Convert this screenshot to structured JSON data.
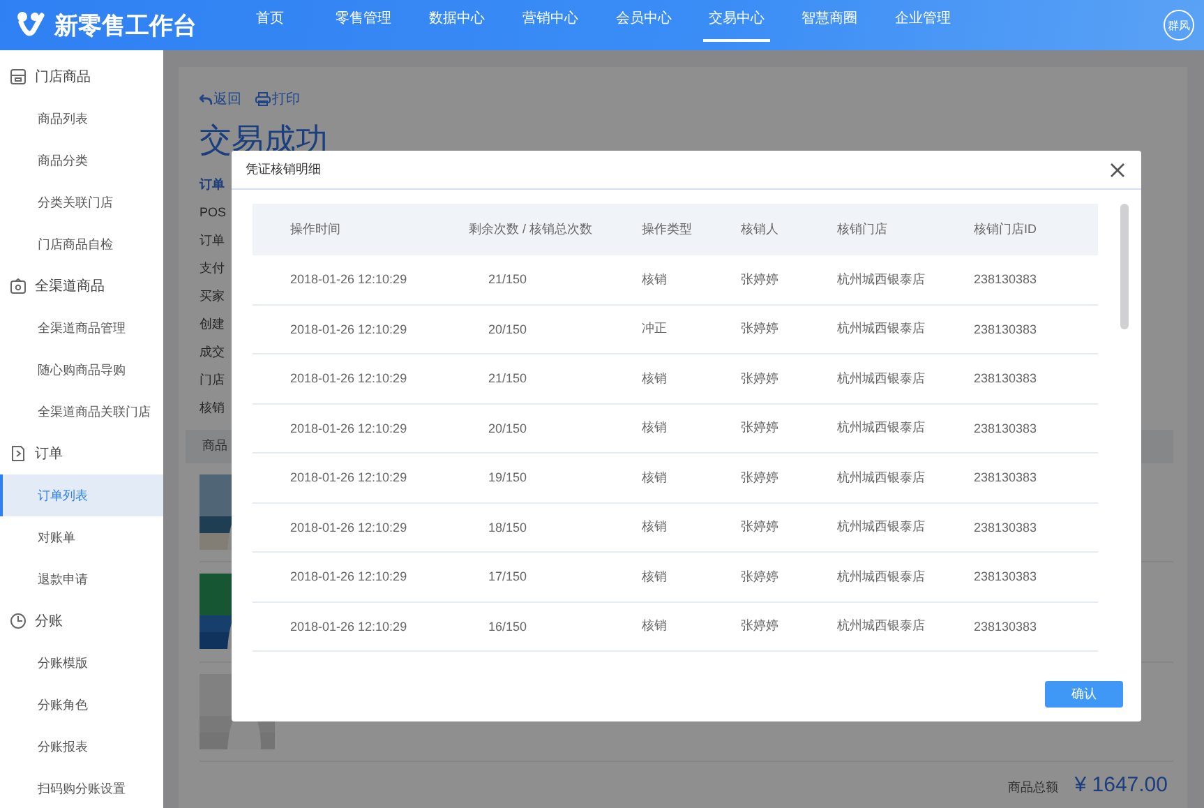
{
  "topbar": {
    "brand": "新零售工作台",
    "avatar": "群风",
    "nav": [
      {
        "label": "首页",
        "selected": false
      },
      {
        "label": "零售管理",
        "selected": false
      },
      {
        "label": "数据中心",
        "selected": false
      },
      {
        "label": "营销中心",
        "selected": false
      },
      {
        "label": "会员中心",
        "selected": false
      },
      {
        "label": "交易中心",
        "selected": true
      },
      {
        "label": "智慧商圈",
        "selected": false
      },
      {
        "label": "企业管理",
        "selected": false
      }
    ]
  },
  "sidebar": {
    "groups": [
      {
        "title": "门店商品",
        "items": [
          {
            "label": "商品列表",
            "selected": false
          },
          {
            "label": "商品分类",
            "selected": false
          },
          {
            "label": "分类关联门店",
            "selected": false
          },
          {
            "label": "门店商品自检",
            "selected": false
          }
        ]
      },
      {
        "title": "全渠道商品",
        "items": [
          {
            "label": "全渠道商品管理",
            "selected": false
          },
          {
            "label": "随心购商品导购",
            "selected": false
          },
          {
            "label": "全渠道商品关联门店",
            "selected": false
          }
        ]
      },
      {
        "title": "订单",
        "items": [
          {
            "label": "订单列表",
            "selected": true
          },
          {
            "label": "对账单",
            "selected": false
          },
          {
            "label": "退款申请",
            "selected": false
          }
        ]
      },
      {
        "title": "分账",
        "items": [
          {
            "label": "分账模版",
            "selected": false
          },
          {
            "label": "分账角色",
            "selected": false
          },
          {
            "label": "分账报表",
            "selected": false
          },
          {
            "label": "扫码购分账设置",
            "selected": false
          }
        ]
      }
    ]
  },
  "page": {
    "back": "返回",
    "print": "打印",
    "title": "交易成功",
    "info_labels": [
      {
        "text": "订单",
        "kind": "heading"
      },
      {
        "text": "POS",
        "kind": "label"
      },
      {
        "text": "订单",
        "kind": "label"
      },
      {
        "text": "支付",
        "kind": "label"
      },
      {
        "text": "买家",
        "kind": "label"
      },
      {
        "text": "创建",
        "kind": "label"
      },
      {
        "text": "成交",
        "kind": "label"
      },
      {
        "text": "门店",
        "kind": "label"
      },
      {
        "text": "核销",
        "kind": "label"
      }
    ],
    "products_header": "商品",
    "total_label": "商品总额",
    "total": "¥ 1647.00"
  },
  "modal": {
    "title": "凭证核销明细",
    "columns": [
      "操作时间",
      "剩余次数 / 核销总次数",
      "操作类型",
      "核销人",
      "核销门店",
      "核销门店ID"
    ],
    "rows": [
      [
        "2018-01-26  12:10:29",
        "21/150",
        "核销",
        "张婷婷",
        "杭州城西银泰店",
        "238130383"
      ],
      [
        "2018-01-26  12:10:29",
        "20/150",
        "冲正",
        "张婷婷",
        "杭州城西银泰店",
        "238130383"
      ],
      [
        "2018-01-26  12:10:29",
        "21/150",
        "核销",
        "张婷婷",
        "杭州城西银泰店",
        "238130383"
      ],
      [
        "2018-01-26  12:10:29",
        "20/150",
        "核销",
        "张婷婷",
        "杭州城西银泰店",
        "238130383"
      ],
      [
        "2018-01-26  12:10:29",
        "19/150",
        "核销",
        "张婷婷",
        "杭州城西银泰店",
        "238130383"
      ],
      [
        "2018-01-26  12:10:29",
        "18/150",
        "核销",
        "张婷婷",
        "杭州城西银泰店",
        "238130383"
      ],
      [
        "2018-01-26  12:10:29",
        "17/150",
        "核销",
        "张婷婷",
        "杭州城西银泰店",
        "238130383"
      ],
      [
        "2018-01-26  12:10:29",
        "16/150",
        "核销",
        "张婷婷",
        "杭州城西银泰店",
        "238130383"
      ]
    ],
    "confirm": "确认"
  }
}
